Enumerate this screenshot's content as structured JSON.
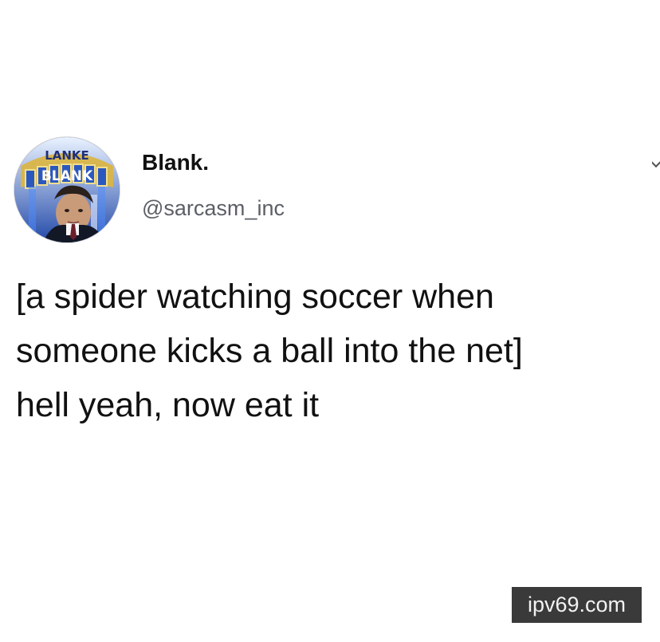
{
  "tweet": {
    "user": {
      "name": "Blank.",
      "handle": "@sarcasm_inc",
      "avatar_text": {
        "top": "LANKE",
        "bottom": "BLANK"
      }
    },
    "text": "[a spider watching soccer when\nsomeone kicks a ball into the net]\nhell yeah, now eat it"
  },
  "watermark": {
    "text": "ipv69.com"
  },
  "icons": {
    "menu": "chevron-down-icon"
  }
}
